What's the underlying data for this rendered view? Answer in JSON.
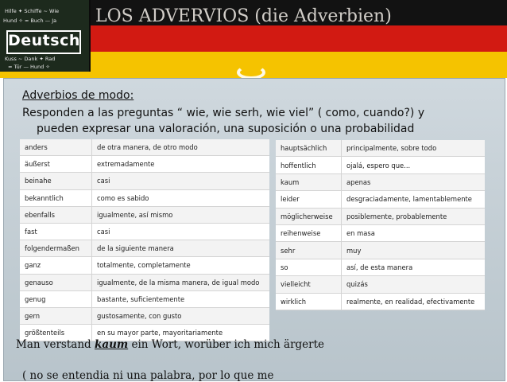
{
  "slide": {
    "title": "LOS ADVERVIOS (die Adverbien)",
    "logo_text": "Deutsch",
    "heading": "Adverbios de modo:",
    "lead_line1": "Responden a las preguntas “ wie, wie serh, wie viel” ( como, cuando?) y",
    "lead_line2": "pueden expresar una valoración, una suposición o una probabilidad",
    "example_before": "Man verstand ",
    "example_word": "kaum",
    "example_after": " ein Wort, worüber ich mich ärgerte",
    "example_translation": "( no se entendia ni una palabra, por lo que me"
  },
  "left_table": [
    {
      "de": "anders",
      "es": "de otra manera, de otro modo"
    },
    {
      "de": "äußerst",
      "es": "extremadamente"
    },
    {
      "de": "beinahe",
      "es": "casi"
    },
    {
      "de": "bekanntlich",
      "es": "como es sabido"
    },
    {
      "de": "ebenfalls",
      "es": "igualmente, así mismo"
    },
    {
      "de": "fast",
      "es": "casi"
    },
    {
      "de": "folgendermaßen",
      "es": "de la siguiente manera"
    },
    {
      "de": "ganz",
      "es": "totalmente, completamente"
    },
    {
      "de": "genauso",
      "es": "igualmente, de la misma manera, de igual modo"
    },
    {
      "de": "genug",
      "es": "bastante, suficientemente"
    },
    {
      "de": "gern",
      "es": "gustosamente, con gusto"
    },
    {
      "de": "größtenteils",
      "es": "en su mayor parte, mayoritariamente"
    }
  ],
  "right_table": [
    {
      "de": "hauptsächlich",
      "es": "principalmente, sobre todo"
    },
    {
      "de": "hoffentlich",
      "es": "ojalá, espero que..."
    },
    {
      "de": "kaum",
      "es": "apenas"
    },
    {
      "de": "leider",
      "es": "desgraciadamente, lamentablemente"
    },
    {
      "de": "möglicherweise",
      "es": "posiblemente, probablemente"
    },
    {
      "de": "reihenweise",
      "es": "en masa"
    },
    {
      "de": "sehr",
      "es": "muy"
    },
    {
      "de": "so",
      "es": "así, de esta manera"
    },
    {
      "de": "vielleicht",
      "es": "quizás"
    },
    {
      "de": "wirklich",
      "es": "realmente, en realidad, efectivamente"
    }
  ]
}
